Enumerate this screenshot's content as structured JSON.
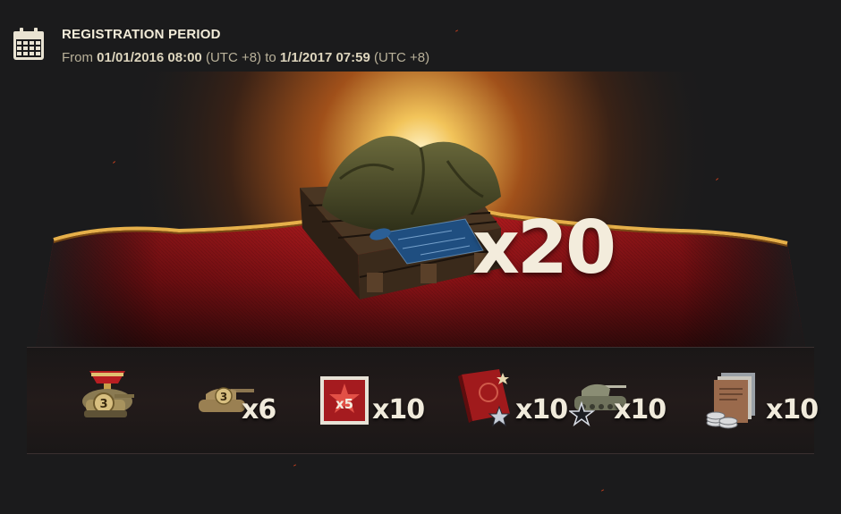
{
  "registration": {
    "title": "REGISTRATION PERIOD",
    "from_label": "From",
    "start": "01/01/2016 08:00",
    "tz1": "(UTC +8)",
    "to_label": "to",
    "end": "1/1/2017 07:59",
    "tz2": "(UTC +8)"
  },
  "main_reward": {
    "icon": "covered-tank-crate-icon",
    "multiplier": "x20"
  },
  "rewards": [
    {
      "icon": "medal-tier3-tank-icon",
      "count": ""
    },
    {
      "icon": "tank-tier3-icon",
      "count": "x6"
    },
    {
      "icon": "x5-star-booster-icon",
      "count": "x10"
    },
    {
      "icon": "manual-book-icon",
      "count": "x10"
    },
    {
      "icon": "tank-star-icon",
      "count": "x10"
    },
    {
      "icon": "documents-coins-icon",
      "count": "x10"
    }
  ],
  "colors": {
    "accent_red": "#b0171c",
    "gold": "#e6b04a",
    "background": "#1b1b1c"
  }
}
